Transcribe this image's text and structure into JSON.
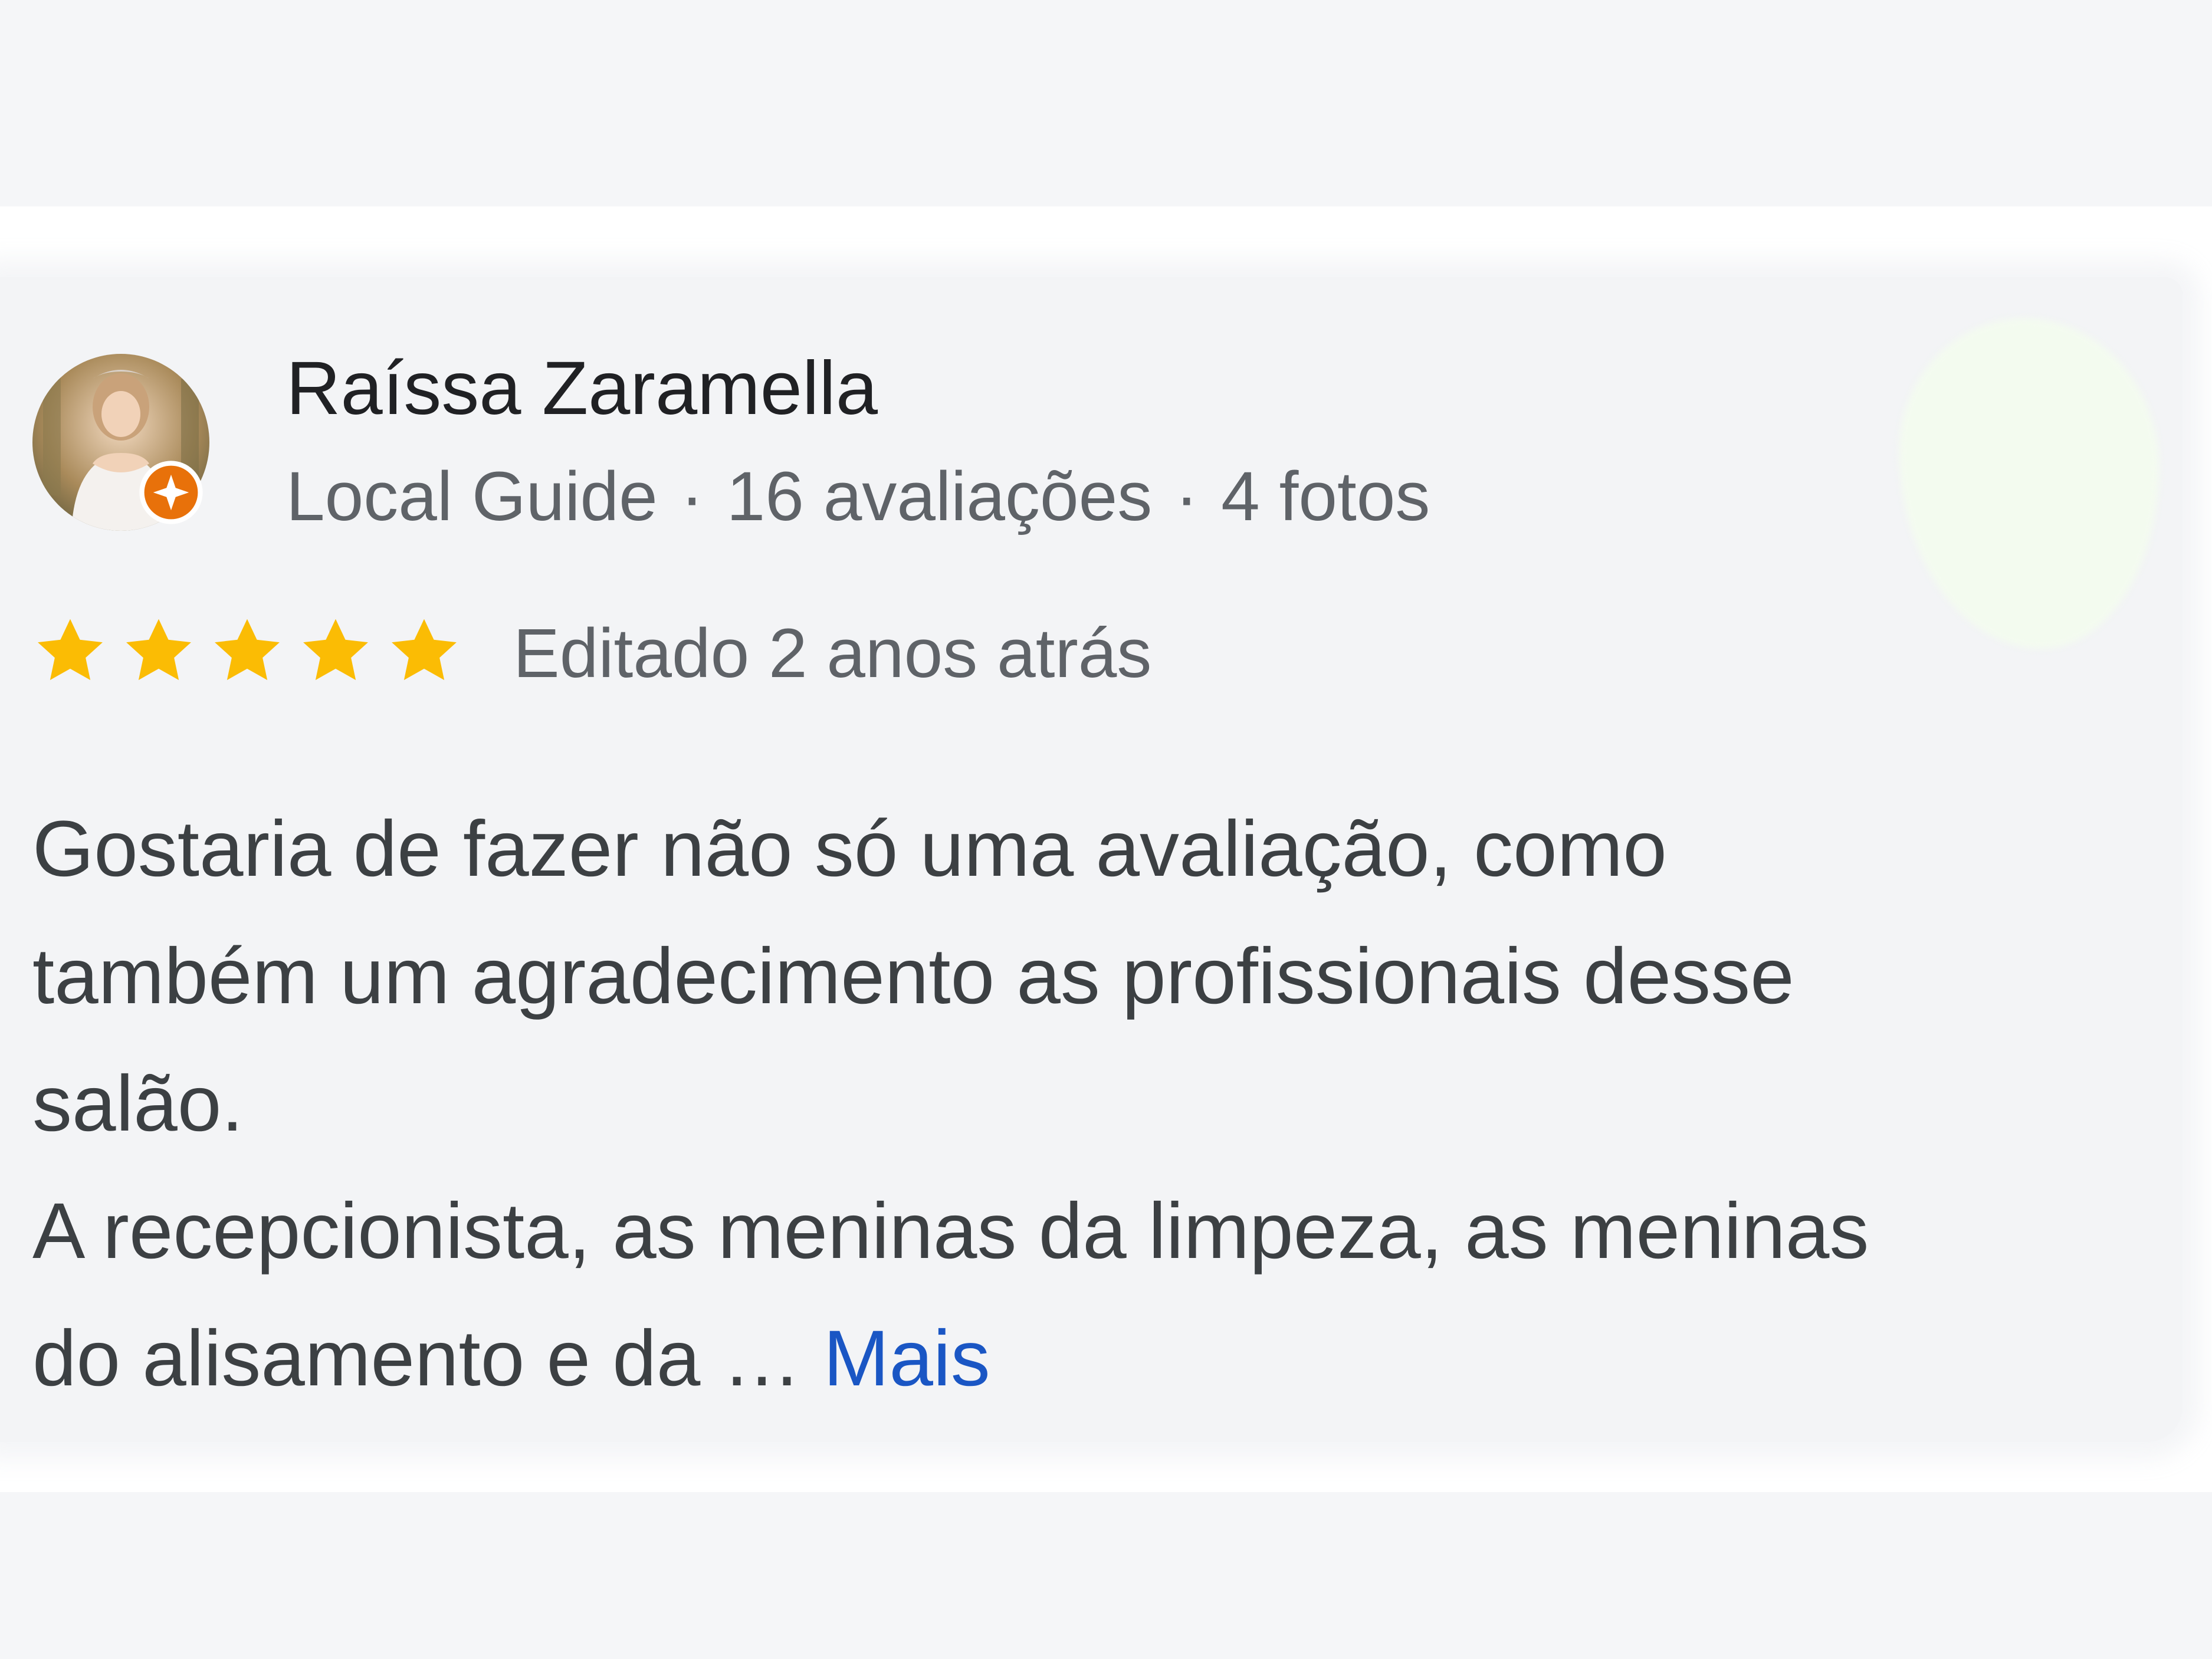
{
  "reviewer": {
    "name": "Raíssa Zaramella",
    "badge": "Local Guide",
    "reviews": "16 avaliações",
    "photos": "4 fotos",
    "separator": "·"
  },
  "rating": {
    "stars": 5,
    "max": 5,
    "date": "Editado 2 anos atrás"
  },
  "review": {
    "lines": [
      "Gostaria de fazer não só uma avaliação, como",
      "também um agradecimento as profissionais desse",
      "salão.",
      "A recepcionista, as meninas da limpeza, as meninas",
      "do alisamento e da …"
    ],
    "more_label": "Mais"
  },
  "colors": {
    "star": "#fbbc04",
    "link": "#1a56c4",
    "badge": "#e8710a"
  },
  "icons": {
    "avatar": "profile-photo",
    "badge": "local-guide-badge-icon",
    "star": "star-icon"
  }
}
